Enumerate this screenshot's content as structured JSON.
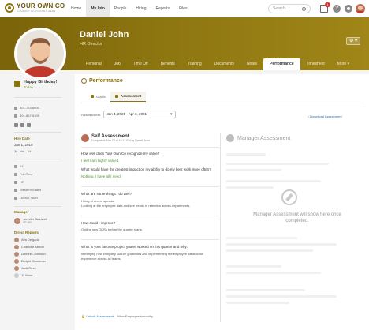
{
  "brand": {
    "name": "YOUR OWN CO",
    "tagline": "COMPANY LOGO GOES HERE",
    "accent": "#8a7313"
  },
  "topnav": {
    "items": [
      "Home",
      "My Info",
      "People",
      "Hiring",
      "Reports",
      "Files"
    ],
    "active_index": 1,
    "search_placeholder": "Search...",
    "inbox_count": "1"
  },
  "employee": {
    "name": "Daniel John",
    "title": "HR Director"
  },
  "profile_tabs": {
    "items": [
      "Personal",
      "Job",
      "Time Off",
      "Benefits",
      "Training",
      "Documents",
      "Notes",
      "Performance",
      "Timesheet",
      "More"
    ],
    "active_index": 7
  },
  "sidebar": {
    "birthday_title": "Happy Birthday!",
    "birthday_sub": "Today",
    "phones": [
      "801-724-6600",
      "801-867-5309"
    ],
    "hire_label": "Hire Date",
    "hire_date": "Jan 1, 2019",
    "hire_duration": "3y - 4m - 1d",
    "details": [
      "#11",
      "Full-Time",
      "HR",
      "Western States",
      "Lindon, Utah"
    ],
    "manager_label": "Manager",
    "manager_name": "Jennifer Caldwell",
    "manager_role": "VP HR",
    "reports_label": "Direct Reports",
    "reports": [
      "Ava Delgado",
      "Charlotte Abbott",
      "Dominic Johnson",
      "Dwight Goodman",
      "Jack Rees",
      "11 More..."
    ]
  },
  "performance": {
    "title": "Performance",
    "subtabs": [
      "Goals",
      "Assessment"
    ],
    "active_subtab": 1,
    "assessment_label": "Assessment",
    "assessment_period": "Jan 4, 2021 - Apr 3, 2021",
    "download_link": "Download Assessment"
  },
  "self_assessment": {
    "title": "Self Assessment",
    "completed": "Completed: Mar 29 at 10:12 PM by Daniel John",
    "q1": "How well does Your Own Co recognize my value?",
    "a1": "I feel I am highly valued.",
    "q2": "What would have the greatest impact on my ability to do my best work more often?",
    "a2": "Nothing, I have all I need.",
    "q3": "What are some things I do well?",
    "a3_line1": "Hiring of recent speeds.",
    "a3_line2": "Looking at the employee data and see trends in retention across departments.",
    "q4": "How could I improve?",
    "a4": "Outline new OKRs before the quarter starts.",
    "q5": "What is your favorite project you've worked on this quarter and why?",
    "a5": "Identifying new company culture guidelines and implementing the employee satisfaction experience across all teams."
  },
  "manager_assessment": {
    "title": "Manager Assessment",
    "message": "Manager Assessment will show here once completed."
  },
  "footer": {
    "unlock_link": "Unlock Assessment",
    "unlock_note": " – Allow Employee to modify"
  }
}
